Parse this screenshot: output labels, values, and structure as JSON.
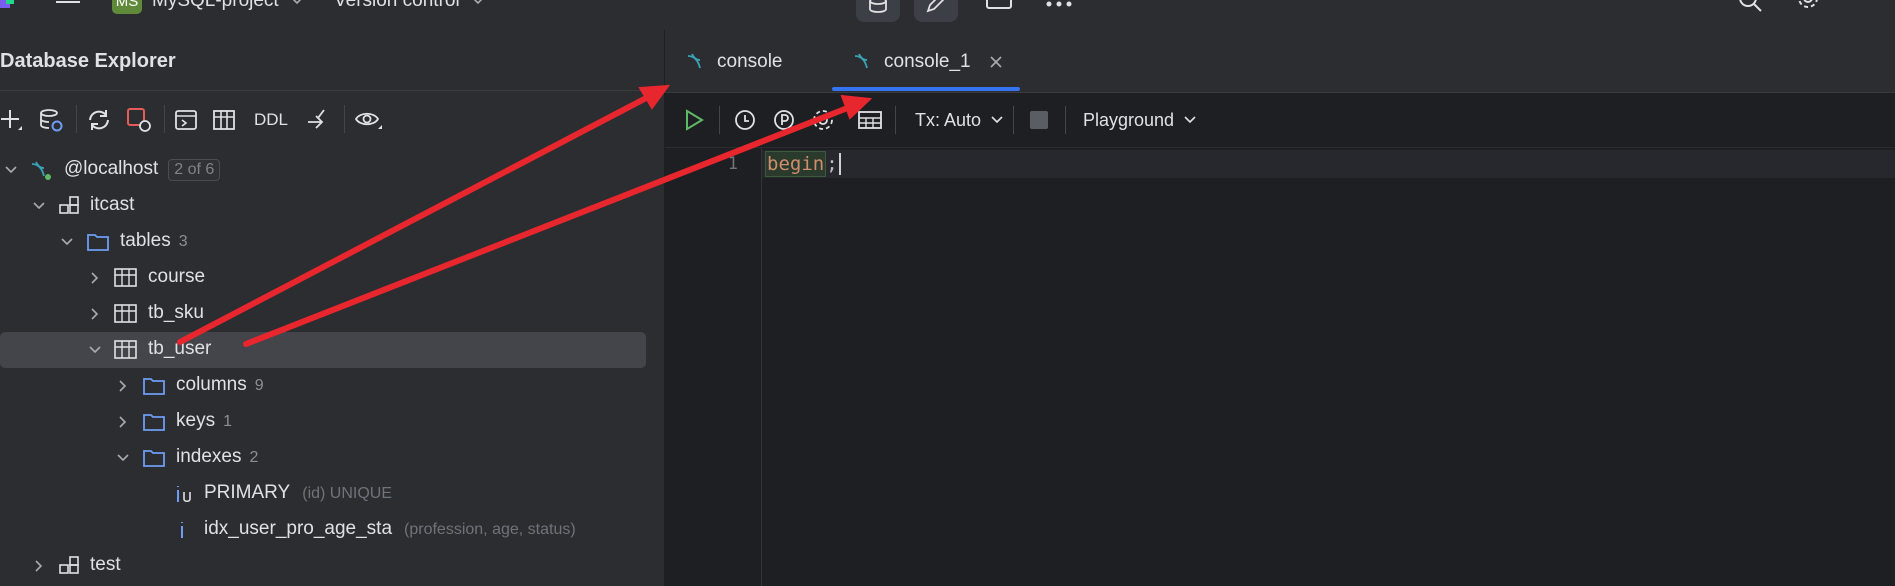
{
  "topbar": {
    "project_badge": "MS",
    "project_name": "MySQL-project",
    "vcs_label": "Version control"
  },
  "panel": {
    "title": "Database Explorer",
    "toolbar": {
      "ddl_label": "DDL"
    }
  },
  "tree": {
    "host": {
      "label": "@localhost",
      "badge": "2 of 6"
    },
    "schema": {
      "label": "itcast"
    },
    "tables": {
      "label": "tables",
      "count": "3"
    },
    "course": {
      "label": "course"
    },
    "tb_sku": {
      "label": "tb_sku"
    },
    "tb_user": {
      "label": "tb_user"
    },
    "columns": {
      "label": "columns",
      "count": "9"
    },
    "keys": {
      "label": "keys",
      "count": "1"
    },
    "indexes": {
      "label": "indexes",
      "count": "2"
    },
    "primary": {
      "label": "PRIMARY",
      "meta": "(id) UNIQUE"
    },
    "idx": {
      "label": "idx_user_pro_age_sta",
      "meta": "(profession, age, status)"
    },
    "test": {
      "label": "test"
    }
  },
  "editor": {
    "tabs": [
      {
        "label": "console"
      },
      {
        "label": "console_1"
      }
    ],
    "toolbar": {
      "tx_label": "Tx: Auto",
      "playground_label": "Playground"
    },
    "line_number": "1",
    "code": {
      "keyword": "begin",
      "punct": ";"
    }
  },
  "colors": {
    "accent": "#3574f0",
    "annotation_arrow": "#e8262d",
    "run_green": "#5fb865",
    "db_icon_teal": "#3aa3b7",
    "folder_blue": "#6e9cf5"
  },
  "icons": [
    "hamburger-icon",
    "database-icon",
    "edit-icon",
    "square-icon",
    "more-icon",
    "search-icon",
    "gear-icon",
    "plus-icon",
    "datasource-icon",
    "refresh-icon",
    "stop-icon",
    "console-icon",
    "table-icon",
    "jump-icon",
    "eye-icon",
    "chevron-icon",
    "folder-icon",
    "index-icon",
    "run-icon",
    "history-icon",
    "pin-icon",
    "settings-icon",
    "grid-icon",
    "close-icon"
  ]
}
